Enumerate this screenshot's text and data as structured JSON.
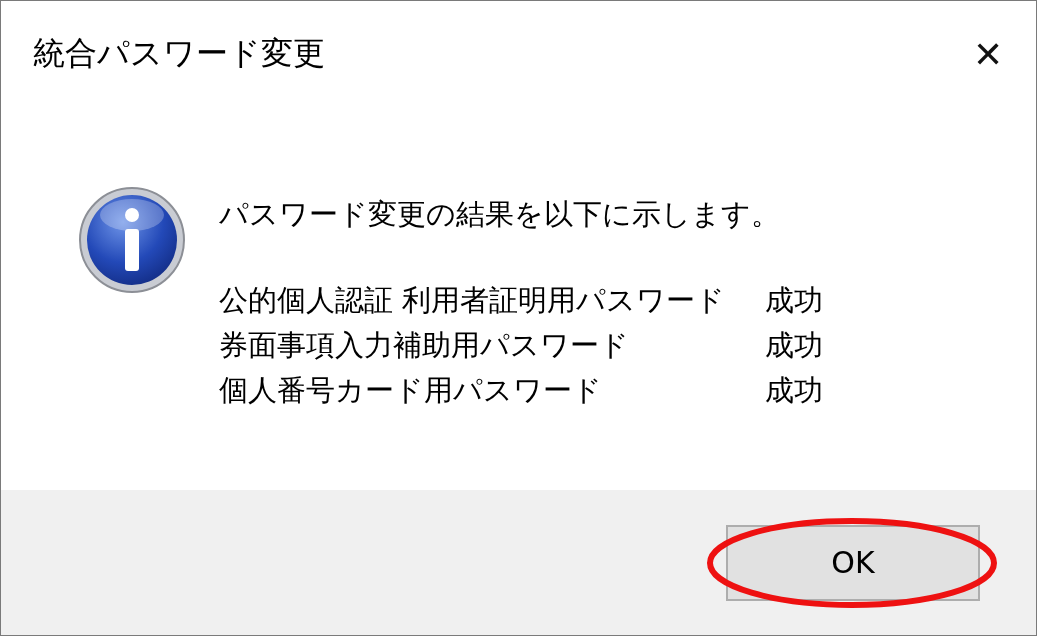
{
  "window": {
    "title": "統合パスワード変更",
    "close": "✕"
  },
  "message": {
    "intro": "パスワード変更の結果を以下に示します。",
    "results": [
      {
        "label": "公的個人認証 利用者証明用パスワード",
        "result": "成功"
      },
      {
        "label": "券面事項入力補助用パスワード",
        "result": "成功"
      },
      {
        "label": "個人番号カード用パスワード",
        "result": "成功"
      }
    ]
  },
  "buttons": [
    {
      "label": "OK",
      "highlighted": true
    }
  ]
}
